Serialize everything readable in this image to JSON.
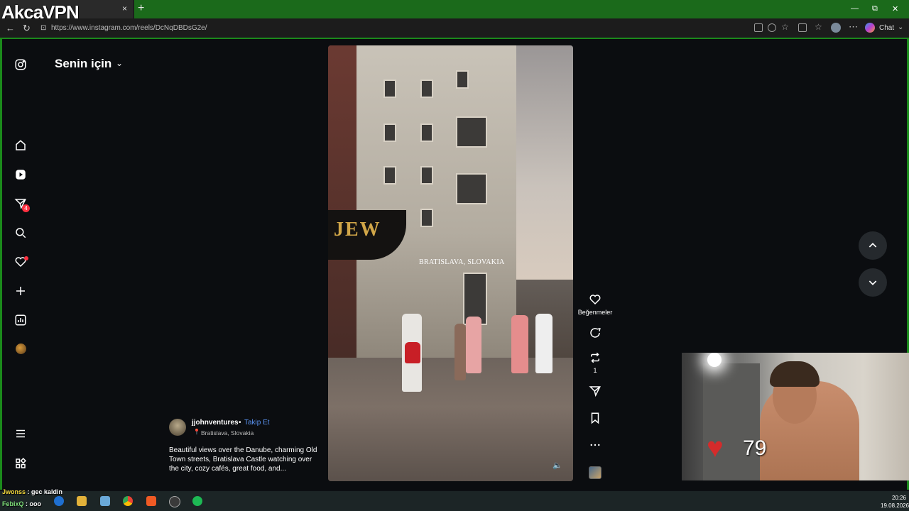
{
  "browser": {
    "vpn_overlay": "AkcaVPN",
    "url": "https://www.instagram.com/reels/DcNqDBDsG2e/",
    "chat_label": "Chat",
    "new_tab": "+",
    "tab_close": "×",
    "minimize": "—",
    "restore": "⧉",
    "close": "✕"
  },
  "sidebar": {
    "icons": [
      "instagram-icon",
      "home-icon",
      "reels-icon",
      "messages-icon",
      "search-icon",
      "notifications-icon",
      "create-icon",
      "dashboard-icon",
      "profile-avatar",
      "menu-icon",
      "more-apps-icon"
    ],
    "messages_badge": "4"
  },
  "feed": {
    "title": "Senin için"
  },
  "reel": {
    "video_caption": "BRATISLAVA, SLOVAKIA",
    "storefront_text": "JEW",
    "author": "jjohnventures",
    "separator": "•",
    "follow_label": "Takip Et",
    "location": "Bratislava, Slovakia",
    "description": "Beautiful views over the Danube, charming Old Town streets, Bratislava Castle watching over the city, cozy cafés, great food, and...",
    "likes_label": "Beğenmeler",
    "repost_count": "1"
  },
  "overlay": {
    "heart_rate": "79"
  },
  "chat": [
    {
      "user": "Jwonss",
      "message": "gec kaldin"
    },
    {
      "user": "FebixQ",
      "message": "ooo"
    }
  ],
  "taskbar": {
    "time": "20:26",
    "date": "19.08.2026"
  },
  "colors": {
    "accent_green": "#1b8a1b",
    "follow_blue": "#5b95f5",
    "badge_red": "#ff3040"
  }
}
